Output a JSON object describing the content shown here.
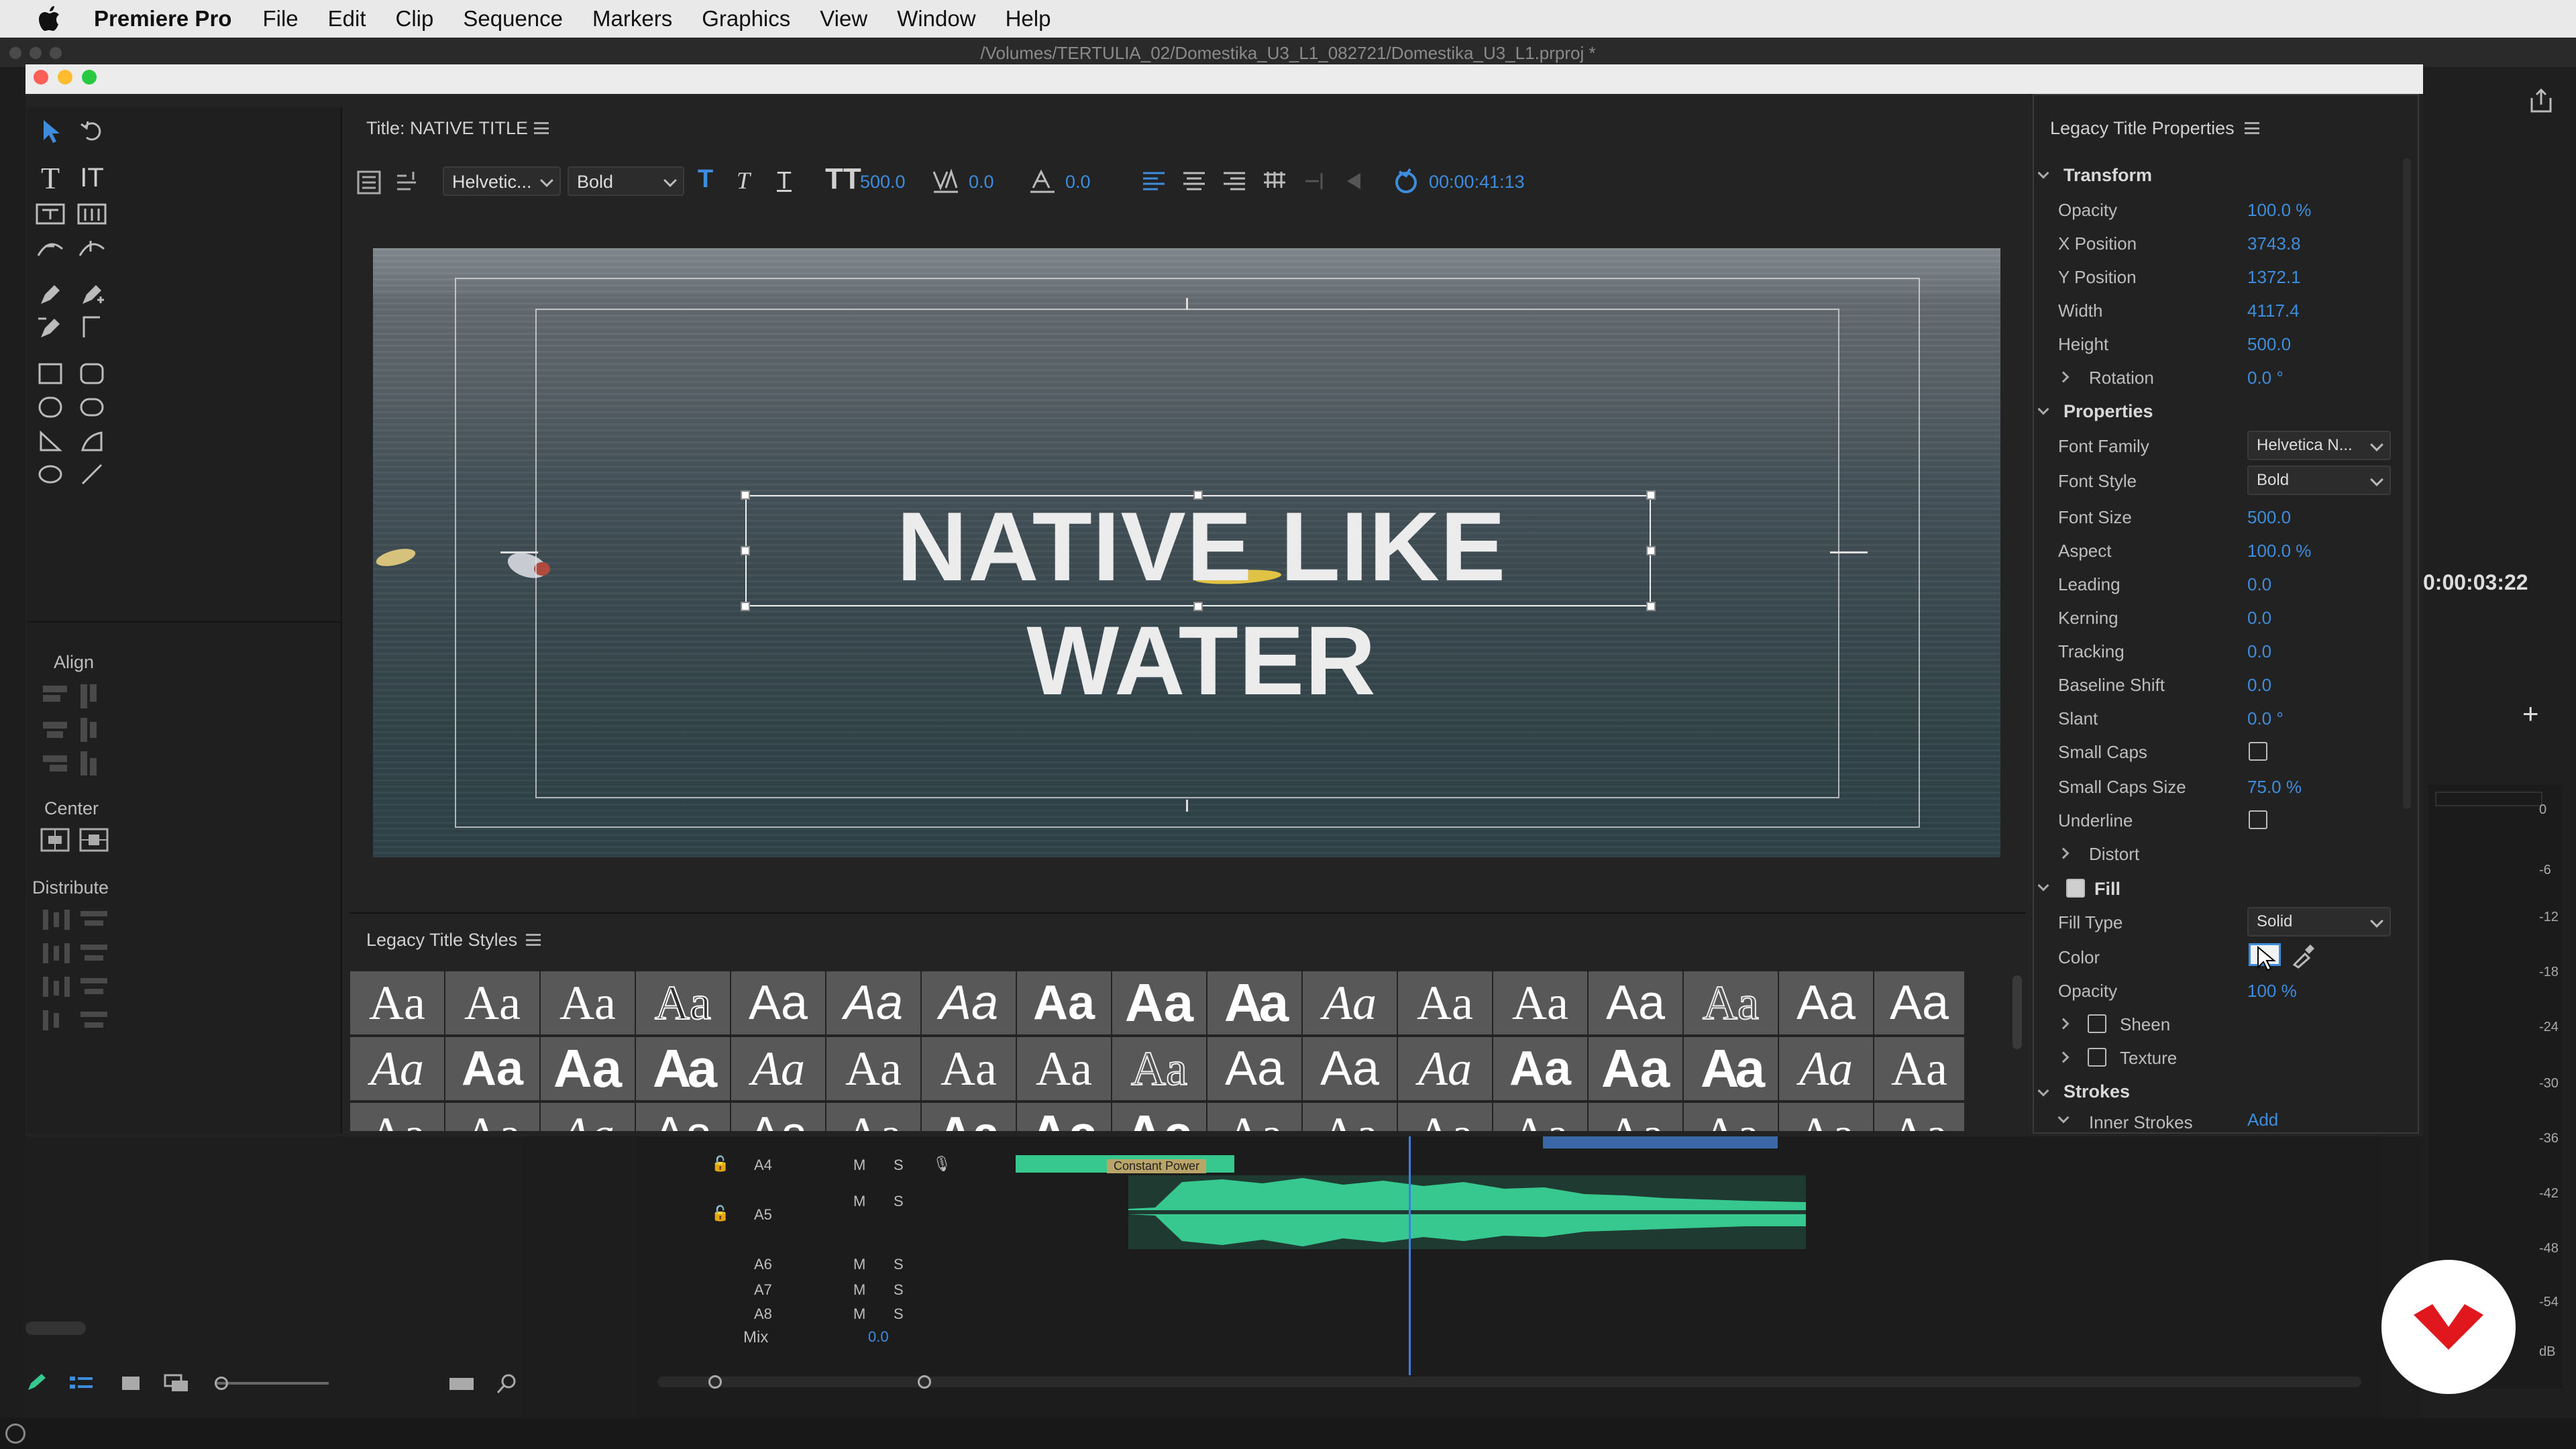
{
  "menubar": {
    "app_name": "Premiere Pro",
    "items": [
      "File",
      "Edit",
      "Clip",
      "Sequence",
      "Markers",
      "Graphics",
      "View",
      "Window",
      "Help"
    ]
  },
  "window": {
    "path": "/Volumes/TERTULIA_02/Domestika_U3_L1_082721/Domestika_U3_L1.prproj *"
  },
  "title_panel": {
    "title": "Title: NATIVE TITLE",
    "font_family": "Helvetic...",
    "font_style": "Bold",
    "font_size": "500.0",
    "kerning": "0.0",
    "baseline": "0.0",
    "timecode": "00:00:41:13"
  },
  "canvas": {
    "text": "NATIVE LIKE WATER"
  },
  "tools": {
    "align_label": "Align",
    "center_label": "Center",
    "distribute_label": "Distribute"
  },
  "styles_panel": {
    "title": "Legacy Title Styles",
    "swatch_text": "Aa"
  },
  "props": {
    "title": "Legacy Title Properties",
    "transform": {
      "label": "Transform",
      "opacity_label": "Opacity",
      "opacity": "100.0 %",
      "x_label": "X Position",
      "x": "3743.8",
      "y_label": "Y Position",
      "y": "1372.1",
      "width_label": "Width",
      "width": "4117.4",
      "height_label": "Height",
      "height": "500.0",
      "rotation_label": "Rotation",
      "rotation": "0.0 °"
    },
    "properties": {
      "label": "Properties",
      "font_family_label": "Font Family",
      "font_family": "Helvetica N...",
      "font_style_label": "Font Style",
      "font_style": "Bold",
      "font_size_label": "Font Size",
      "font_size": "500.0",
      "aspect_label": "Aspect",
      "aspect": "100.0 %",
      "leading_label": "Leading",
      "leading": "0.0",
      "kerning_label": "Kerning",
      "kerning": "0.0",
      "tracking_label": "Tracking",
      "tracking": "0.0",
      "baseline_label": "Baseline Shift",
      "baseline": "0.0",
      "slant_label": "Slant",
      "slant": "0.0 °",
      "small_caps_label": "Small Caps",
      "small_caps_size_label": "Small Caps Size",
      "small_caps_size": "75.0 %",
      "underline_label": "Underline",
      "distort_label": "Distort"
    },
    "fill": {
      "label": "Fill",
      "fill_type_label": "Fill Type",
      "fill_type": "Solid",
      "color_label": "Color",
      "opacity_label": "Opacity",
      "opacity": "100 %",
      "sheen_label": "Sheen",
      "texture_label": "Texture"
    },
    "strokes": {
      "label": "Strokes",
      "inner_label": "Inner Strokes",
      "add_label": "Add"
    }
  },
  "background": {
    "timecode": "0:00:03:22",
    "clip_label": "Constant Power",
    "tracks": [
      "A4",
      "A5",
      "A6",
      "A7",
      "A8"
    ],
    "track_m": "M",
    "track_s": "S",
    "mix_label": "Mix",
    "mix_value": "0.0",
    "meter_ticks": [
      "0",
      "-6",
      "-12",
      "-18",
      "-24",
      "-30",
      "-36",
      "-42",
      "-48",
      "-54",
      "dB"
    ]
  },
  "colors": {
    "accent_blue": "#3e8ddd",
    "waveform_green": "#36c88f",
    "logo_red": "#e0181e"
  }
}
